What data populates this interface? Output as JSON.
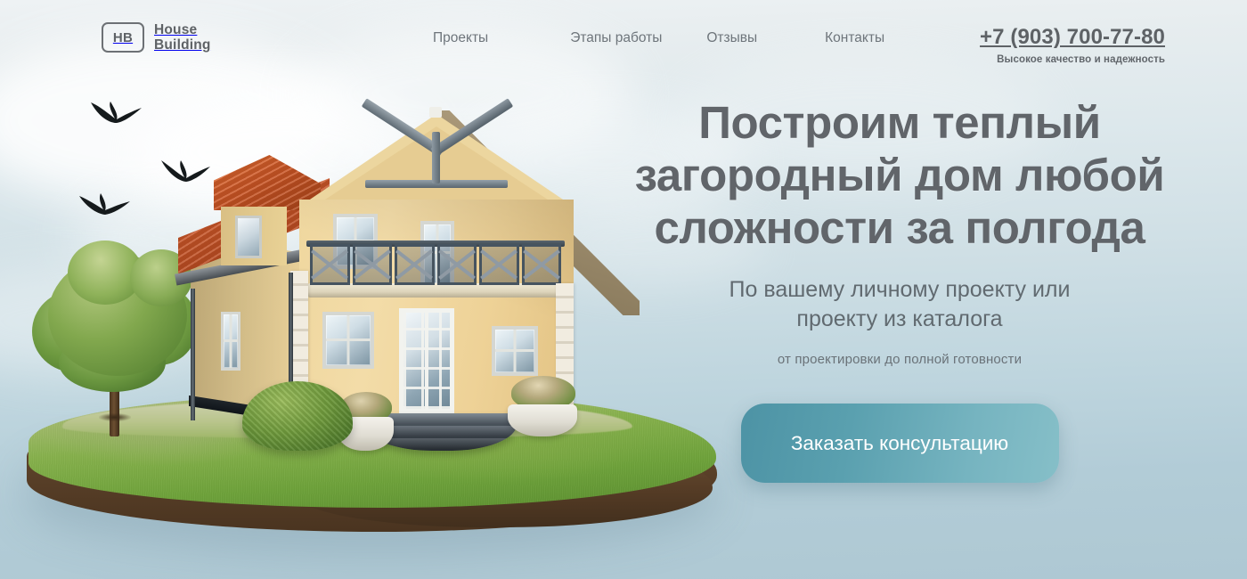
{
  "header": {
    "logo": {
      "badge": "HB",
      "line1": "House",
      "line2": "Building"
    },
    "nav": [
      {
        "label": "Проекты",
        "name": "nav-projects"
      },
      {
        "label": "Этапы работы",
        "name": "nav-stages"
      },
      {
        "label": "Отзывы",
        "name": "nav-reviews"
      },
      {
        "label": "Контакты",
        "name": "nav-contacts"
      }
    ],
    "contact": {
      "phone": "+7 (903) 700-77-80",
      "slogan": "Высокое качество и надежность"
    }
  },
  "hero": {
    "headline_line1": "Построим теплый",
    "headline_line2": "загородный дом любой",
    "headline_line3": "сложности за полгода",
    "subhead_line1": "По вашему личному проекту или",
    "subhead_line2": "проекту из каталога",
    "tertiary": "от проектировки до полной готовности",
    "cta_label": "Заказать консультацию"
  },
  "illustration": {
    "alt": "Двухэтажный загородный дом с балконом на островке с газоном, деревом и кустами",
    "birds_count": 3
  },
  "colors": {
    "background_top": "#eef2f4",
    "background_bottom": "#aec8d3",
    "heading_gray": "#61656a",
    "body_gray": "#6e757b",
    "cta_gradient_start": "#4d93a5",
    "cta_gradient_end": "#86bfc8",
    "house_wall": "#eed69e",
    "roof_terracotta": "#c75427",
    "rail_slate": "#465460",
    "grass_green": "#6ea23a",
    "soil_brown": "#5b4129"
  }
}
